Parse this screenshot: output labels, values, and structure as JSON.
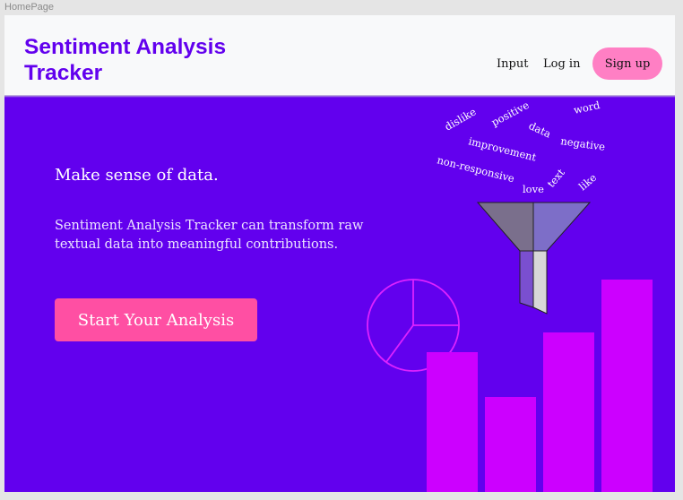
{
  "frame": {
    "label": "HomePage"
  },
  "header": {
    "logo": "Sentiment Analysis\nTracker",
    "nav": [
      {
        "label": "Input"
      },
      {
        "label": "Log in"
      }
    ],
    "signup_label": "Sign up"
  },
  "hero": {
    "headline": "Make sense of data.",
    "description": "Sentiment Analysis Tracker can transform raw textual data into meaningful contributions.",
    "cta_label": "Start Your Analysis"
  },
  "word_cloud": [
    {
      "text": "dislike"
    },
    {
      "text": "positive"
    },
    {
      "text": "word"
    },
    {
      "text": "data"
    },
    {
      "text": "improvement"
    },
    {
      "text": "negative"
    },
    {
      "text": "non-responsive"
    },
    {
      "text": "love"
    },
    {
      "text": "text"
    },
    {
      "text": "like"
    }
  ],
  "colors": {
    "brand": "#6200ee",
    "hero_bg": "#6200ee",
    "header_bg": "#f8f9fa",
    "cta": "#ff4fa3",
    "signup": "#ff7fc4",
    "bars": "#cc00ff",
    "pie_stroke": "#dd22ff"
  },
  "icons": [
    "funnel-icon",
    "pie-chart-icon",
    "bar-chart-icon"
  ]
}
